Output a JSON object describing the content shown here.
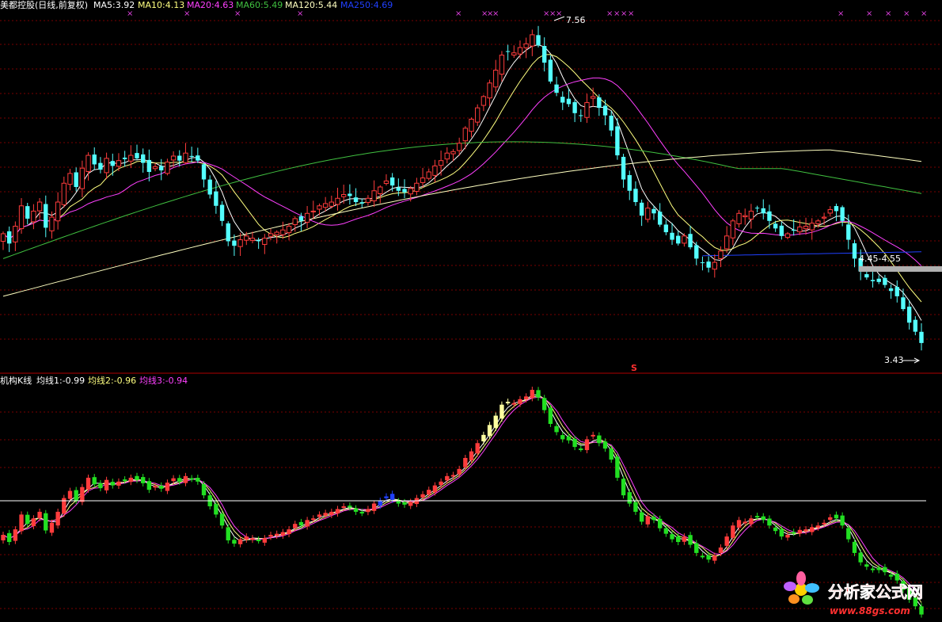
{
  "top_legend": {
    "name": "美都控股(日线,前复权)",
    "ma5": "MA5:3.92",
    "ma10": "MA10:4.13",
    "ma20": "MA20:4.63",
    "ma60": "MA60:5.49",
    "ma120": "MA120:5.44",
    "ma250": "MA250:4.69"
  },
  "bottom_legend": {
    "name": "机构K线",
    "avg1": "均线1:-0.99",
    "avg2": "均线2:-0.96",
    "avg3": "均线3:-0.94"
  },
  "annotations": {
    "high": "7.56",
    "low": "3.43",
    "range": "4.45-4.55",
    "marker": "S"
  },
  "watermark": {
    "name": "分析家公式网",
    "url": "www.88gs.com"
  },
  "colors": {
    "up": "#ff3c3c",
    "down_price": "#54ffff",
    "down_indicator": "#22e022",
    "ma5": "#ffffff",
    "ma10": "#ffff80",
    "ma20": "#ff40ff",
    "ma60": "#40c040",
    "ma120": "#ffffc0",
    "ma250": "#2040ff",
    "grid": "#7a0000",
    "cross_marks": "#e040e0"
  },
  "chart_data": [
    {
      "type": "candlestick",
      "title": "美都控股(日线,前复权)",
      "ylim": [
        3.25,
        7.75
      ],
      "close": [
        4.88,
        4.75,
        4.98,
        5.25,
        5.08,
        5.18,
        5.3,
        4.96,
        5.1,
        5.3,
        5.55,
        5.68,
        5.5,
        5.75,
        5.92,
        5.8,
        5.73,
        5.88,
        5.78,
        5.85,
        5.87,
        5.92,
        5.88,
        5.82,
        5.7,
        5.77,
        5.72,
        5.83,
        5.91,
        5.85,
        5.95,
        5.9,
        5.85,
        5.6,
        5.4,
        5.25,
        5.05,
        4.78,
        4.72,
        4.8,
        4.85,
        4.82,
        4.78,
        4.82,
        4.88,
        4.9,
        4.93,
        4.98,
        5.08,
        5.05,
        5.15,
        5.18,
        5.25,
        5.28,
        5.3,
        5.35,
        5.4,
        5.38,
        5.3,
        5.28,
        5.35,
        5.45,
        5.5,
        5.58,
        5.52,
        5.45,
        5.43,
        5.48,
        5.55,
        5.62,
        5.7,
        5.78,
        5.85,
        5.95,
        5.97,
        6.08,
        6.28,
        6.4,
        6.55,
        6.7,
        6.88,
        7.05,
        7.25,
        7.3,
        7.28,
        7.35,
        7.4,
        7.52,
        7.38,
        7.15,
        6.9,
        6.75,
        6.62,
        6.6,
        6.48,
        6.45,
        6.62,
        6.7,
        6.55,
        6.45,
        6.25,
        5.92,
        5.6,
        5.45,
        5.3,
        5.12,
        5.22,
        5.15,
        5.0,
        4.9,
        4.8,
        4.75,
        4.85,
        4.7,
        4.55,
        4.5,
        4.43,
        4.5,
        4.65,
        4.85,
        5.05,
        5.15,
        5.12,
        5.18,
        5.22,
        5.15,
        5.05,
        4.95,
        4.85,
        4.88,
        4.92,
        4.97,
        4.98,
        5.02,
        5.05,
        5.1,
        5.2,
        5.18,
        5.05,
        4.8,
        4.55,
        4.38,
        4.3,
        4.25,
        4.24,
        4.2,
        4.12,
        4.05,
        3.88,
        3.7,
        3.58,
        3.43
      ],
      "high_label": "7.56",
      "low_label": "3.43"
    },
    {
      "type": "candlestick",
      "title": "机构K线",
      "ylim": [
        -1.2,
        1.05
      ],
      "series": [
        {
          "name": "均线1",
          "last": -0.99
        },
        {
          "name": "均线2",
          "last": -0.96
        },
        {
          "name": "均线3",
          "last": -0.94
        }
      ]
    }
  ]
}
